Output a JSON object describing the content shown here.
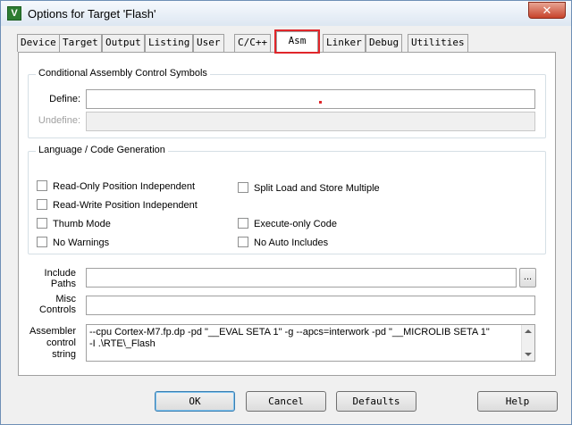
{
  "window": {
    "title": "Options for Target 'Flash'",
    "close_glyph": "✕",
    "app_icon_glyph": "V"
  },
  "tabs": [
    {
      "label": "Device"
    },
    {
      "label": "Target"
    },
    {
      "label": "Output"
    },
    {
      "label": "Listing"
    },
    {
      "label": "User"
    },
    {
      "label": "C/C++"
    },
    {
      "label": "Asm",
      "active": true
    },
    {
      "label": "Linker"
    },
    {
      "label": "Debug"
    },
    {
      "label": "Utilities"
    }
  ],
  "conditional_group": {
    "title": "Conditional Assembly Control Symbols",
    "define_label": "Define:",
    "define_value": "",
    "undefine_label": "Undefine:",
    "undefine_value": ""
  },
  "language_group": {
    "title": "Language / Code Generation",
    "left_options": [
      {
        "label": "Read-Only Position Independent",
        "checked": false
      },
      {
        "label": "Read-Write Position Independent",
        "checked": false
      },
      {
        "label": "Thumb Mode",
        "checked": false
      },
      {
        "label": "No Warnings",
        "checked": false
      }
    ],
    "right_options": [
      {
        "label": "Split Load and Store Multiple",
        "checked": false
      },
      {
        "label": "Execute-only Code",
        "checked": false
      },
      {
        "label": "No Auto Includes",
        "checked": false
      }
    ]
  },
  "include": {
    "label_line1": "Include",
    "label_line2": "Paths",
    "value": "",
    "browse_label": "..."
  },
  "misc": {
    "label_line1": "Misc",
    "label_line2": "Controls",
    "value": ""
  },
  "assembler": {
    "label_line1": "Assembler",
    "label_line2": "control",
    "label_line3": "string",
    "line1": "--cpu Cortex-M7.fp.dp -pd \"__EVAL SETA 1\" -g --apcs=interwork -pd \"__MICROLIB SETA 1\"",
    "line2": "-I .\\RTE\\_Flash"
  },
  "buttons": {
    "ok": "OK",
    "cancel": "Cancel",
    "defaults": "Defaults",
    "help": "Help"
  },
  "colors": {
    "highlight": "#e0262a",
    "title_bar": "#dde7f2",
    "close_button": "#c7432b"
  }
}
